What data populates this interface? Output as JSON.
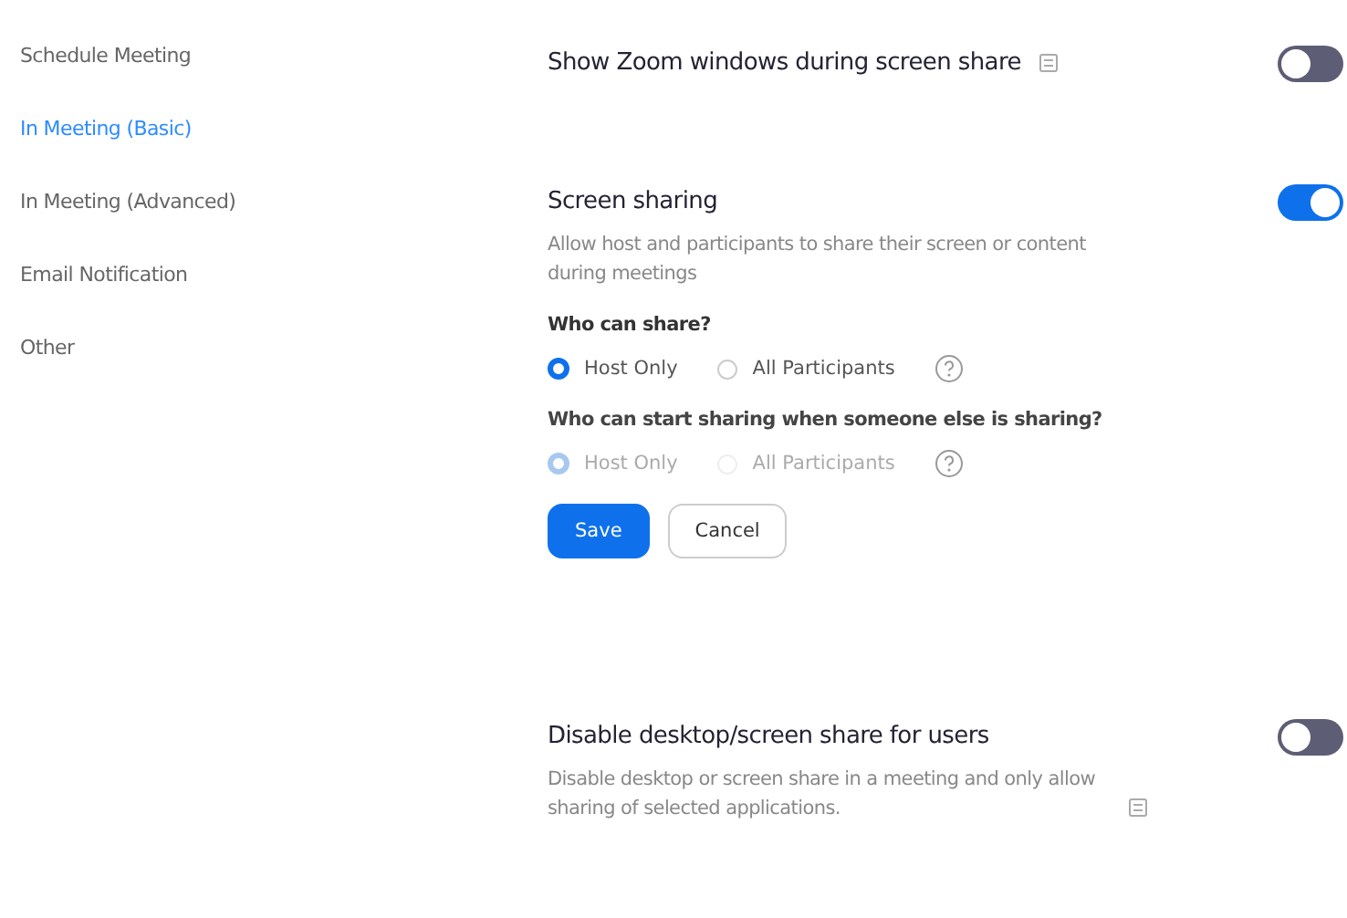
{
  "sidebar": {
    "items": [
      {
        "label": "Schedule Meeting",
        "selected": false
      },
      {
        "label": "In Meeting (Basic)",
        "selected": true
      },
      {
        "label": "In Meeting (Advanced)",
        "selected": false
      },
      {
        "label": "Email Notification",
        "selected": false
      },
      {
        "label": "Other",
        "selected": false
      }
    ]
  },
  "settings": [
    {
      "title": "Show Zoom windows during screen share",
      "info": true,
      "on": false
    },
    {
      "title": "Screen sharing",
      "description": "Allow host and participants to share their screen or content during meetings",
      "on": true,
      "groups": [
        {
          "question": "Who can share?",
          "disabled": false,
          "options": [
            {
              "label": "Host Only",
              "selected": true
            },
            {
              "label": "All Participants",
              "selected": false
            }
          ]
        },
        {
          "question": "Who can start sharing when someone else is sharing?",
          "disabled": true,
          "options": [
            {
              "label": "Host Only",
              "selected": true
            },
            {
              "label": "All Participants",
              "selected": false
            }
          ]
        }
      ],
      "buttons": [
        {
          "label": "Save",
          "kind": "primary"
        },
        {
          "label": "Cancel",
          "kind": "secondary"
        }
      ]
    },
    {
      "title": "Disable desktop/screen share for users",
      "description": "Disable desktop or screen share in a meeting and only allow sharing of selected applications.",
      "description_info": true,
      "on": false
    }
  ]
}
